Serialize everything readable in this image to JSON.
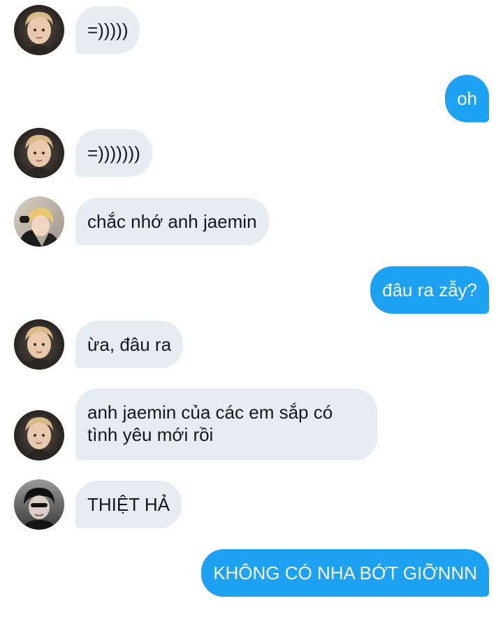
{
  "conversation": {
    "messages": [
      {
        "direction": "incoming",
        "sender_avatar": "avatar-a",
        "text": "=)))))"
      },
      {
        "direction": "outgoing",
        "text": "oh"
      },
      {
        "direction": "incoming",
        "sender_avatar": "avatar-a",
        "text": "=)))))))"
      },
      {
        "direction": "incoming",
        "sender_avatar": "avatar-b",
        "text": "chắc nhớ anh jaemin"
      },
      {
        "direction": "outgoing",
        "text": "đâu ra zẫy?"
      },
      {
        "direction": "incoming",
        "sender_avatar": "avatar-a",
        "text": "ừa, đâu ra"
      },
      {
        "direction": "incoming",
        "sender_avatar": "avatar-a",
        "text": "anh jaemin của các em sắp có tình yêu mới rồi"
      },
      {
        "direction": "incoming",
        "sender_avatar": "avatar-c",
        "text": "THIỆT HẢ"
      },
      {
        "direction": "outgoing",
        "text": "KHÔNG CÓ NHA BỚT GIỠNNN"
      }
    ]
  },
  "colors": {
    "incoming_bubble": "#e6ecf0",
    "outgoing_bubble": "#1da1f2",
    "incoming_text": "#14171a",
    "outgoing_text": "#ffffff"
  }
}
